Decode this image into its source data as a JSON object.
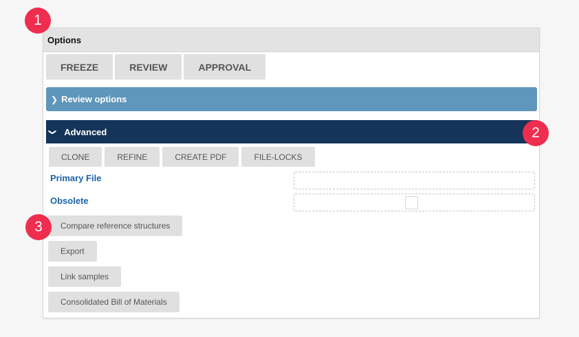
{
  "badges": [
    "1",
    "2",
    "3"
  ],
  "panel": {
    "title": "Options"
  },
  "top_buttons": [
    "FREEZE",
    "REVIEW",
    "APPROVAL"
  ],
  "review_options": {
    "label": "Review options",
    "icon": "chevron-right-icon"
  },
  "advanced": {
    "label": "Advanced",
    "icon": "chevron-down-icon",
    "buttons": [
      "CLONE",
      "REFINE",
      "CREATE PDF",
      "FILE-LOCKS"
    ],
    "primary_file": {
      "label": "Primary File",
      "value": ""
    },
    "obsolete": {
      "label": "Obsolete",
      "checked": false
    },
    "actions": [
      "Compare reference structures",
      "Export",
      "Link samples",
      "Consolidated Bill of Materials"
    ]
  },
  "colors": {
    "review_bar": "#5f96bb",
    "advanced_bar": "#143459",
    "label_blue": "#1a62a8",
    "badge": "#ee2d4f"
  }
}
